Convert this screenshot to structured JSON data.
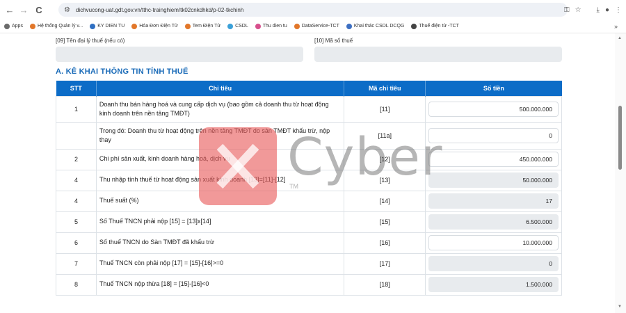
{
  "browser": {
    "url": "dichvucong-uat.gdt.gov.vn/tthc-trainghiem/tk02cnkdhkd/p-02-tkchinh",
    "back_icon": "←",
    "forward_icon": "→",
    "reload_icon": "C",
    "bookmarks": [
      {
        "label": "Apps",
        "color": "#6b6b6b"
      },
      {
        "label": "Hệ thống Quản lý v...",
        "color": "#e2772a"
      },
      {
        "label": "KY DIEN TU",
        "color": "#2f6fc2"
      },
      {
        "label": "Hóa Đơn Điện Tử",
        "color": "#e2772a"
      },
      {
        "label": "Tem Điện Tử",
        "color": "#e2772a"
      },
      {
        "label": "CSDL",
        "color": "#3aa0d8"
      },
      {
        "label": "Thu dien tu",
        "color": "#d74f8d"
      },
      {
        "label": "DataService-TCT",
        "color": "#e2772a"
      },
      {
        "label": "Khai thác CSDL DCQG",
        "color": "#3d6fc2"
      },
      {
        "label": "Thuế điện tử -TCT",
        "color": "#444444"
      }
    ],
    "more_bookmarks": "»"
  },
  "fields": {
    "f09_label": "[09] Tên đại lý thuế (nếu có)",
    "f10_label": "[10] Mã số thuế"
  },
  "section": {
    "title": "A. KÊ KHAI THÔNG TIN TÍNH THUẾ"
  },
  "table": {
    "headers": [
      "STT",
      "Chỉ tiêu",
      "Mã chỉ tiêu",
      "Số tiền"
    ],
    "rows": [
      {
        "stt": "1",
        "chi_tieu": "Doanh thu bán hàng hoá và cung cấp dịch vụ (bao gồm cả doanh thu từ hoạt động kinh doanh trên nền tảng TMĐT)",
        "ma": "[11]",
        "so_tien": "500.000.000",
        "readonly": false
      },
      {
        "stt": "",
        "chi_tieu": "Trong đó: Doanh thu từ hoạt động trên nền tảng TMĐT do sàn TMĐT khấu trừ, nộp thay",
        "ma": "[11a]",
        "so_tien": "0",
        "readonly": false
      },
      {
        "stt": "2",
        "chi_tieu": "Chi phí sản xuất, kinh doanh hàng hoá, dịch vụ",
        "ma": "[12]",
        "so_tien": "450.000.000",
        "readonly": false
      },
      {
        "stt": "4",
        "chi_tieu": "Thu nhập tính thuế từ hoạt động sản xuất kinh doanh [13]=[11]-[12]",
        "ma": "[13]",
        "so_tien": "50.000.000",
        "readonly": true
      },
      {
        "stt": "4",
        "chi_tieu": "Thuế suất (%)",
        "ma": "[14]",
        "so_tien": "17",
        "readonly": true
      },
      {
        "stt": "5",
        "chi_tieu": "Số Thuế TNCN phải nộp [15] = [13]x[14]",
        "ma": "[15]",
        "so_tien": "6.500.000",
        "readonly": true
      },
      {
        "stt": "6",
        "chi_tieu": "Số thuế TNCN do Sàn TMĐT đã khấu trừ",
        "ma": "[16]",
        "so_tien": "10.000.000",
        "readonly": false
      },
      {
        "stt": "7",
        "chi_tieu": "Thuế TNCN còn phải nộp [17] = [15]-[16]>=0",
        "ma": "[17]",
        "so_tien": "0",
        "readonly": true
      },
      {
        "stt": "8",
        "chi_tieu": "Thuế TNCN nộp thừa [18] = [15]-[16]<0",
        "ma": "[18]",
        "so_tien": "1.500.000",
        "readonly": true
      }
    ]
  },
  "watermark": {
    "text": "Cyber",
    "tm": "TM"
  }
}
